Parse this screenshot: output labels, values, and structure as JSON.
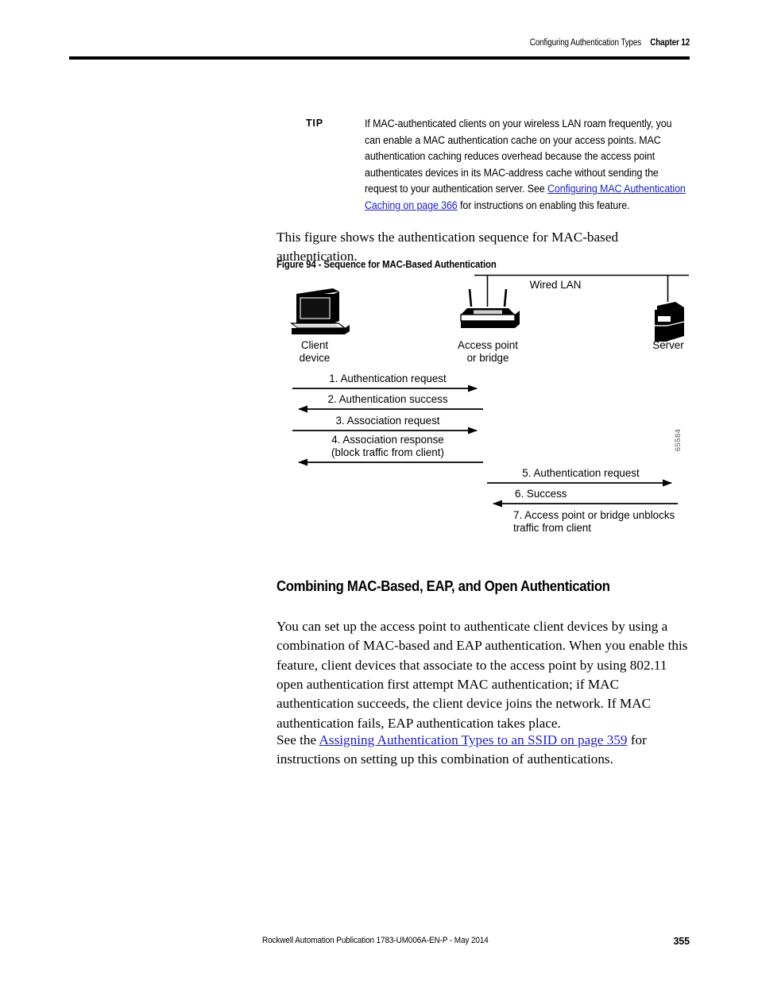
{
  "header": {
    "section_title": "Configuring Authentication Types",
    "chapter": "Chapter 12"
  },
  "tip": {
    "label": "TIP",
    "text_before_link": "If MAC-authenticated clients on your wireless LAN roam frequently, you can enable a MAC authentication cache on your access points. MAC authentication caching reduces overhead because the access point authenticates devices in its MAC-address cache without sending the request to your authentication server. See ",
    "link_text": "Configuring MAC Authentication Caching on page 366",
    "text_after_link": " for instructions on enabling this feature."
  },
  "intro": {
    "paragraph": "This figure shows the authentication sequence for MAC-based authentication."
  },
  "figure": {
    "caption": "Figure 94 - Sequence for MAC-Based Authentication",
    "art_number": "65584",
    "nodes": {
      "client_line1": "Client",
      "client_line2": "device",
      "ap_line1": "Access point",
      "ap_line2": "or bridge",
      "server": "Server",
      "wired_lan": "Wired LAN"
    },
    "steps": [
      {
        "num": "1",
        "label": "1. Authentication request",
        "direction": "right",
        "lane": "client-ap"
      },
      {
        "num": "2",
        "label": "2. Authentication success",
        "direction": "left",
        "lane": "client-ap"
      },
      {
        "num": "3",
        "label": "3. Association request",
        "direction": "right",
        "lane": "client-ap"
      },
      {
        "num": "4",
        "label_line1": "4. Association response",
        "label_line2": "(block traffic from client)",
        "direction": "left",
        "lane": "client-ap"
      },
      {
        "num": "5",
        "label": "5. Authentication request",
        "direction": "right",
        "lane": "ap-server"
      },
      {
        "num": "6",
        "label": "6. Success",
        "direction": "left",
        "lane": "ap-server"
      },
      {
        "num": "7",
        "label_line1": "7. Access point or bridge unblocks",
        "label_line2": "traffic from client",
        "direction": "none",
        "lane": "ap-server"
      }
    ]
  },
  "section": {
    "heading": "Combining MAC-Based, EAP, and Open Authentication",
    "paragraph_1": "You can set up the access point to authenticate client devices by using a combination of MAC-based and EAP authentication. When you enable this feature, client devices that associate to the access point by using 802.11 open authentication first attempt MAC authentication; if MAC authentication succeeds, the client device joins the network. If MAC authentication fails, EAP authentication takes place.",
    "paragraph_2_before_link": "See the ",
    "paragraph_2_link": "Assigning Authentication Types to an SSID on page 359",
    "paragraph_2_after_link": " for instructions on setting up this combination of authentications."
  },
  "footer": {
    "publication": "Rockwell Automation Publication 1783-UM006A-EN-P - May 2014",
    "page_number": "355"
  },
  "colors": {
    "link": "#2020c8",
    "rule": "#000000",
    "art_number": "#555555"
  }
}
